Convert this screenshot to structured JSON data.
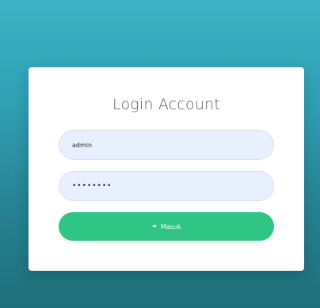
{
  "login": {
    "title": "Login Account",
    "username_value": "admin",
    "password_value": "••••••••",
    "submit_label": "Masuk",
    "submit_icon": "login-arrow-icon"
  },
  "colors": {
    "background_top": "#3cb3c4",
    "background_bottom": "#1f6f7c",
    "input_fill": "#e8f0fe",
    "button": "#2fc685"
  }
}
